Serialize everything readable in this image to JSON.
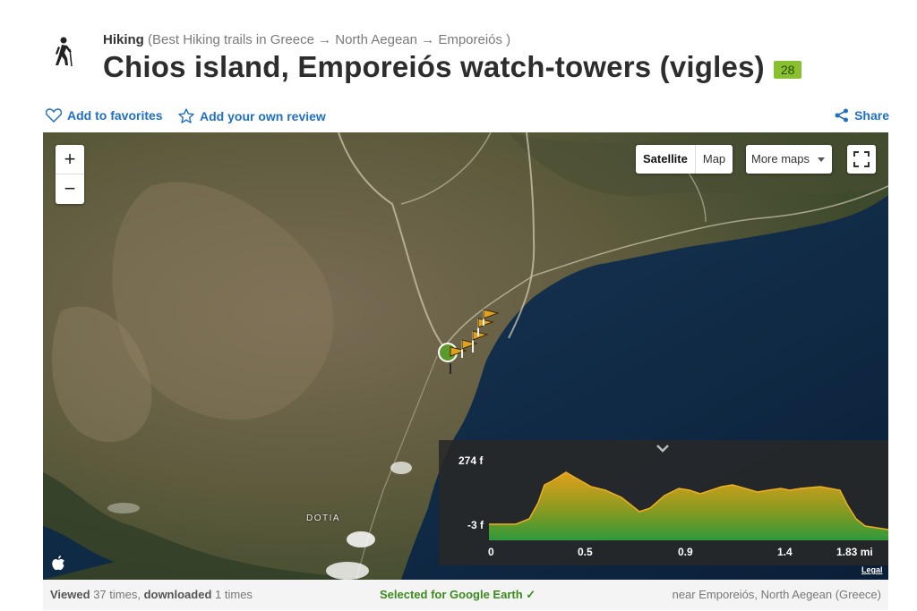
{
  "header": {
    "category": "Hiking",
    "path": "(Best Hiking trails in Greece → North Aegean → Emporeiós )",
    "title": "Chios island, Emporeiós watch-towers (vigles)",
    "badge": "28",
    "badge_color": "#88c02f"
  },
  "actions": {
    "favorites": "Add to favorites",
    "review": "Add your own review",
    "share": "Share",
    "link_color": "#1f6fc5"
  },
  "map": {
    "zoom_in": "+",
    "zoom_out": "−",
    "type_satellite": "Satellite",
    "type_map": "Map",
    "more_maps": "More maps",
    "place_label": "DOTIA",
    "legal": "Legal"
  },
  "elevation": {
    "y_max": "274 f",
    "y_min": "-3 f",
    "x_labels": [
      "0",
      "0.5",
      "0.9",
      "1.4",
      "1.83 mi"
    ]
  },
  "footer": {
    "viewed_label": "Viewed",
    "viewed_text": "37 times,",
    "downloaded_label": "downloaded",
    "downloaded_text": "1 times",
    "google_earth": "Selected for Google Earth ✓",
    "near": "near Emporeiós, North Aegean (Greece)",
    "ge_color": "#3d8a1f"
  }
}
